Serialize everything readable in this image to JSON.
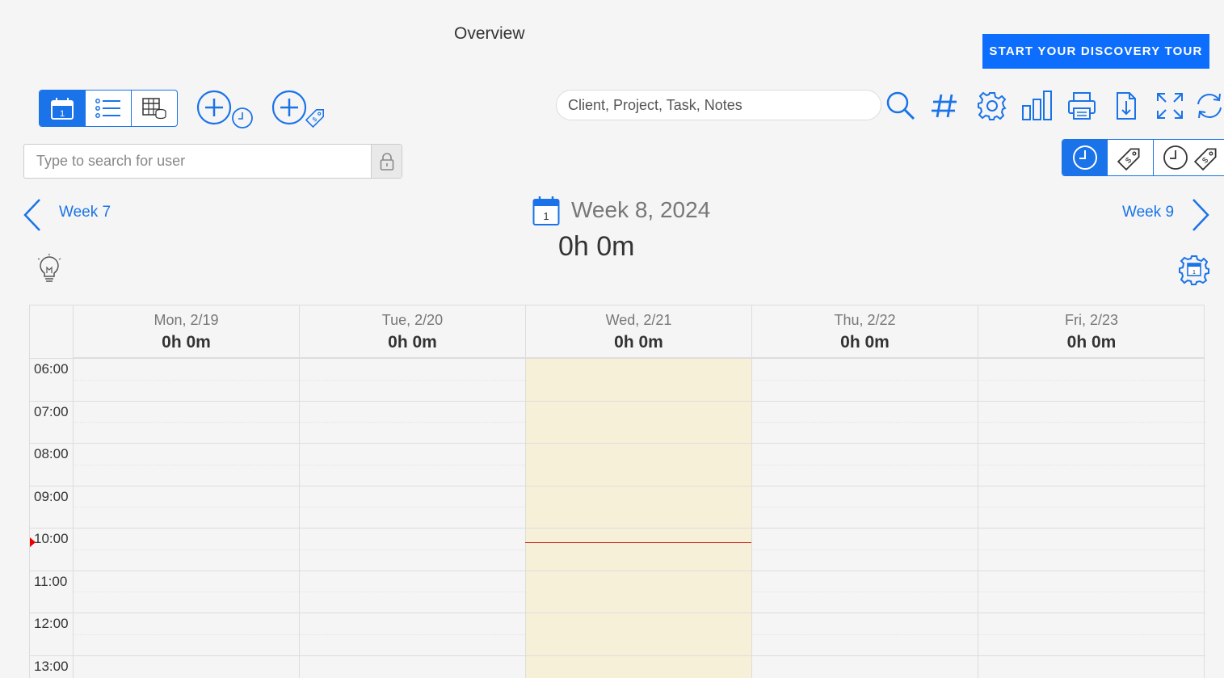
{
  "header": {
    "title": "Overview",
    "tour_button": "START YOUR DISCOVERY TOUR"
  },
  "toolbar": {
    "view_modes": [
      "calendar-icon",
      "list-icon",
      "table-icon"
    ],
    "active_view": "calendar",
    "search_placeholder": "Client, Project, Task, Notes",
    "right_icons": [
      "search-icon",
      "hashtag-icon",
      "gear-icon",
      "bar-chart-icon",
      "printer-icon",
      "export-icon",
      "fullscreen-icon",
      "refresh-icon"
    ]
  },
  "user_search": {
    "placeholder": "Type to search for user"
  },
  "mode_toggle": {
    "items": [
      "clock-icon",
      "tag-icon",
      "clock-tag-icon"
    ],
    "active": "clock"
  },
  "week_nav": {
    "prev": "Week 7",
    "next": "Week 9",
    "title": "Week 8, 2024",
    "total": "0h 0m",
    "calendar_day": "1"
  },
  "calendar": {
    "days": [
      {
        "name": "Mon, 2/19",
        "total": "0h 0m"
      },
      {
        "name": "Tue, 2/20",
        "total": "0h 0m"
      },
      {
        "name": "Wed, 2/21",
        "total": "0h 0m",
        "today": true
      },
      {
        "name": "Thu, 2/22",
        "total": "0h 0m"
      },
      {
        "name": "Fri, 2/23",
        "total": "0h 0m"
      }
    ],
    "hours": [
      "06:00",
      "07:00",
      "08:00",
      "09:00",
      "10:00",
      "11:00",
      "12:00",
      "13:00"
    ],
    "current_time_hour": 10.25
  },
  "colors": {
    "accent": "#1a73e8",
    "button": "#0d6efd",
    "today_bg": "#f7f0d9",
    "now_line": "#cc1a1a"
  }
}
